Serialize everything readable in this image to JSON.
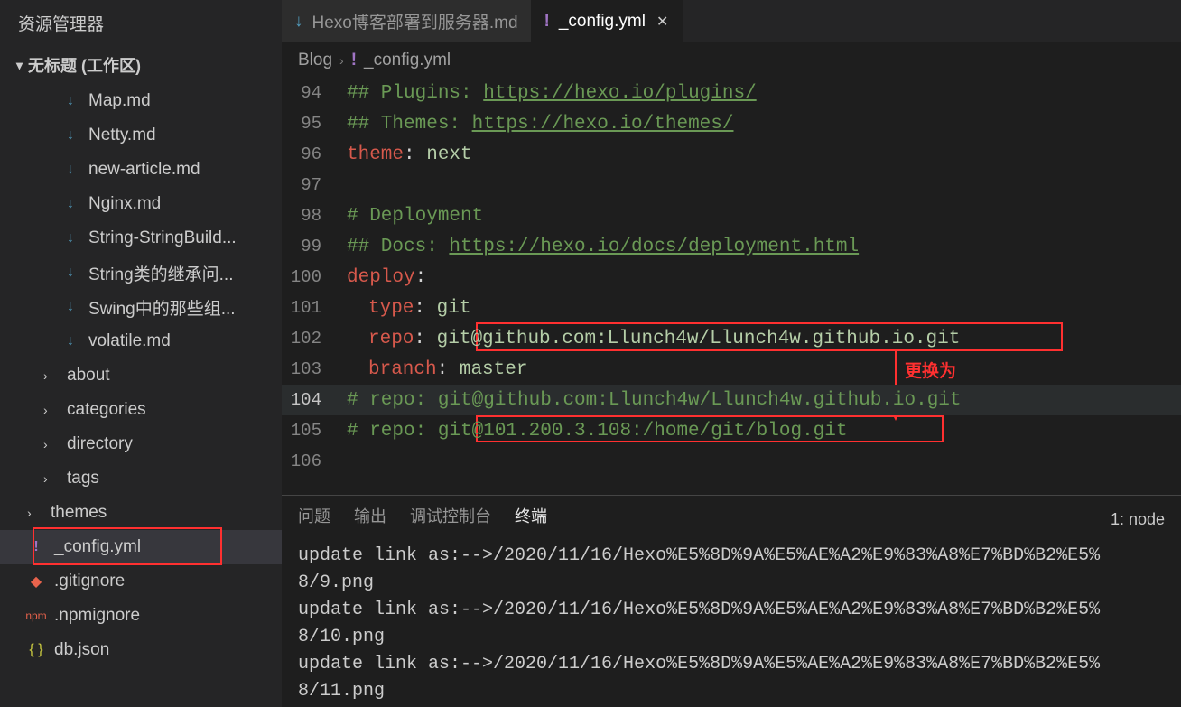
{
  "sidebar": {
    "title": "资源管理器",
    "workspace": "无标题 (工作区)",
    "tree": [
      {
        "type": "md",
        "name": "Map.md"
      },
      {
        "type": "md",
        "name": "Netty.md"
      },
      {
        "type": "md",
        "name": "new-article.md"
      },
      {
        "type": "md",
        "name": "Nginx.md"
      },
      {
        "type": "md",
        "name": "String-StringBuild..."
      },
      {
        "type": "md",
        "name": "String类的继承问..."
      },
      {
        "type": "md",
        "name": "Swing中的那些组..."
      },
      {
        "type": "md",
        "name": "volatile.md"
      },
      {
        "type": "folder",
        "name": "about"
      },
      {
        "type": "folder",
        "name": "categories"
      },
      {
        "type": "folder",
        "name": "directory"
      },
      {
        "type": "folder",
        "name": "tags"
      },
      {
        "type": "folder",
        "name": "themes",
        "root": true
      },
      {
        "type": "yml",
        "name": "_config.yml",
        "active": true,
        "root": true,
        "boxed": true
      },
      {
        "type": "git",
        "name": ".gitignore",
        "root": true
      },
      {
        "type": "npm",
        "name": ".npmignore",
        "root": true
      },
      {
        "type": "json",
        "name": "db.json",
        "root": true
      }
    ]
  },
  "tabs": [
    {
      "icon": "md",
      "label": "Hexo博客部署到服务器.md",
      "active": false
    },
    {
      "icon": "yml",
      "label": "_config.yml",
      "active": true,
      "closeable": true
    }
  ],
  "breadcrumb": {
    "items": [
      "Blog",
      "_config.yml"
    ],
    "icon": "yml"
  },
  "code": {
    "lines": [
      {
        "n": 94,
        "seg": [
          [
            "c-comment",
            "## Plugins: "
          ],
          [
            "c-url2",
            "https://hexo.io/plugins/"
          ]
        ]
      },
      {
        "n": 95,
        "seg": [
          [
            "c-comment",
            "## Themes: "
          ],
          [
            "c-url2",
            "https://hexo.io/themes/"
          ]
        ]
      },
      {
        "n": 96,
        "seg": [
          [
            "c-key",
            "theme"
          ],
          [
            "c-punct",
            ":"
          ],
          [
            "c-str",
            " next"
          ]
        ]
      },
      {
        "n": 97,
        "seg": []
      },
      {
        "n": 98,
        "seg": [
          [
            "c-comment",
            "# Deployment"
          ]
        ]
      },
      {
        "n": 99,
        "seg": [
          [
            "c-comment",
            "## Docs: "
          ],
          [
            "c-url2",
            "https://hexo.io/docs/deployment.html"
          ]
        ]
      },
      {
        "n": 100,
        "seg": [
          [
            "c-key",
            "deploy"
          ],
          [
            "c-punct",
            ":"
          ]
        ]
      },
      {
        "n": 101,
        "indent": 1,
        "seg": [
          [
            "c-key2",
            "type"
          ],
          [
            "c-punct",
            ":"
          ],
          [
            "c-str",
            " git"
          ]
        ]
      },
      {
        "n": 102,
        "indent": 1,
        "seg": [
          [
            "c-key2",
            "repo"
          ],
          [
            "c-punct",
            ":"
          ],
          [
            "c-str",
            " git@github.com:Llunch4w/Llunch4w.github.io.git"
          ]
        ]
      },
      {
        "n": 103,
        "indent": 1,
        "seg": [
          [
            "c-key2",
            "branch"
          ],
          [
            "c-punct",
            ":"
          ],
          [
            "c-str",
            " master"
          ]
        ]
      },
      {
        "n": 104,
        "hl": true,
        "seg": [
          [
            "c-comment",
            "# repo: git@github.com:Llunch4w/Llunch4w.github.io.git"
          ]
        ]
      },
      {
        "n": 105,
        "seg": [
          [
            "c-comment",
            "# repo: git@101.200.3.108:/home/git/blog.git"
          ]
        ]
      },
      {
        "n": 106,
        "seg": []
      }
    ]
  },
  "annotations": {
    "label": "更换为",
    "repo_old": "git@github.com:Llunch4w/Llunch4w.github.io.git",
    "repo_new": "git@101.200.3.108:/home/git/blog.git"
  },
  "terminal": {
    "tabs": [
      "问题",
      "输出",
      "调试控制台",
      "终端"
    ],
    "active_tab": 3,
    "right": "1: node",
    "lines": [
      "update link as:-->/2020/11/16/Hexo%E5%8D%9A%E5%AE%A2%E9%83%A8%E7%BD%B2%E5%",
      "8/9.png",
      "update link as:-->/2020/11/16/Hexo%E5%8D%9A%E5%AE%A2%E9%83%A8%E7%BD%B2%E5%",
      "8/10.png",
      "update link as:-->/2020/11/16/Hexo%E5%8D%9A%E5%AE%A2%E9%83%A8%E7%BD%B2%E5%",
      "8/11.png"
    ]
  }
}
